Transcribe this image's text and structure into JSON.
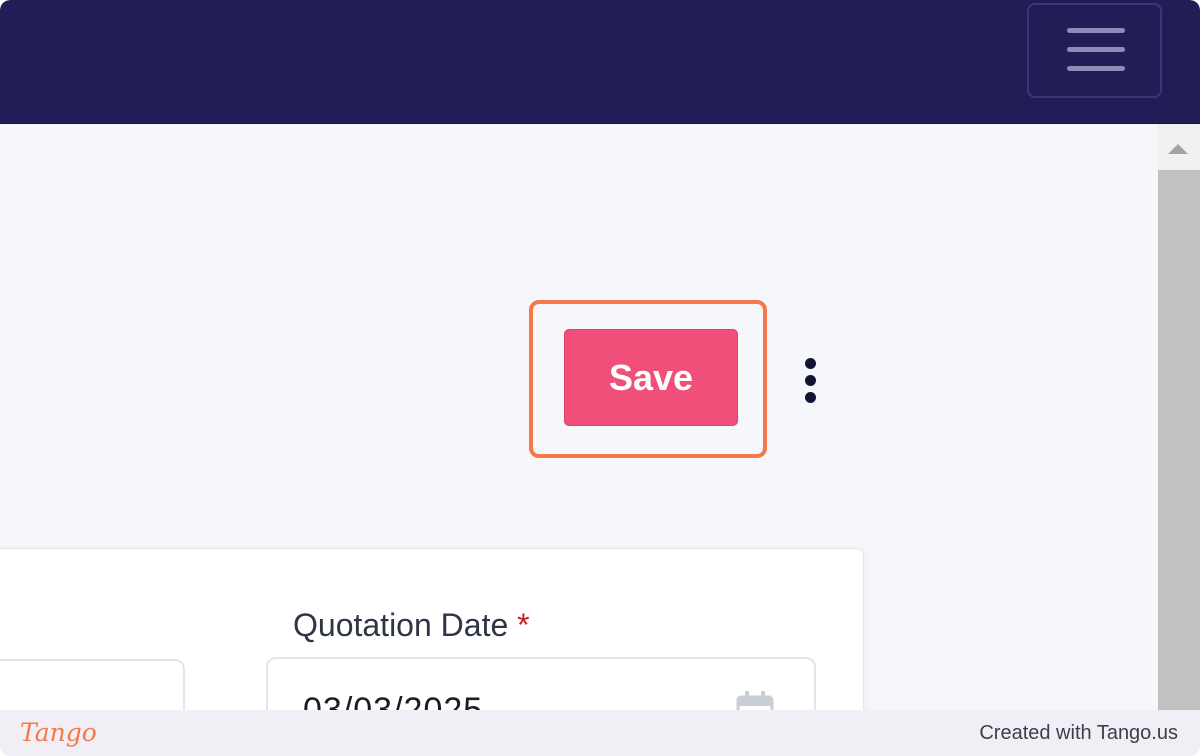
{
  "header": {
    "menu_icon": "hamburger-menu-icon",
    "background_color": "#211e57"
  },
  "toolbar": {
    "save_label": "Save",
    "save_color": "#ef4f78",
    "more_icon": "vertical-ellipsis-icon",
    "highlight_color": "#f5784a"
  },
  "form": {
    "quotation_date_label": "Quotation Date",
    "required_marker": "*",
    "quotation_date_value": "03/03/2025",
    "calendar_icon": "calendar-icon"
  },
  "footer": {
    "brand": "Tango",
    "credit": "Created with Tango.us"
  }
}
